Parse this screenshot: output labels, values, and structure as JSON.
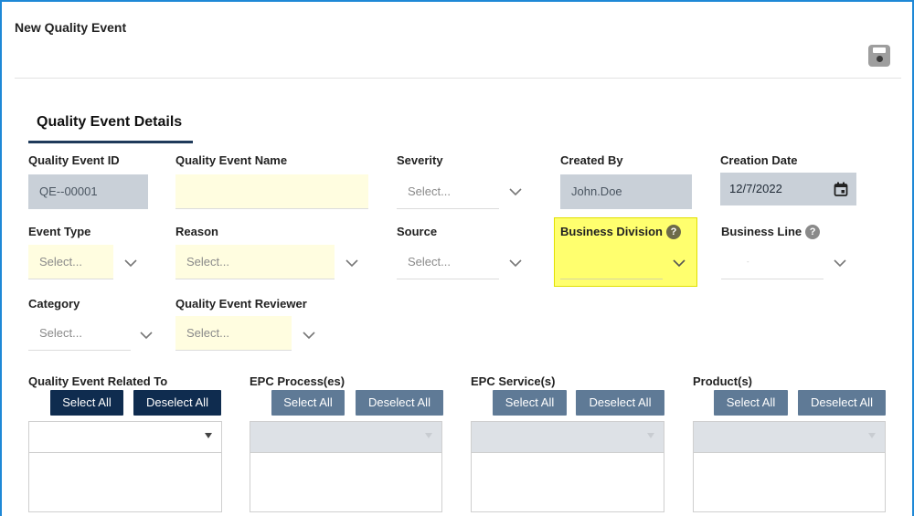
{
  "page": {
    "title": "New Quality Event",
    "save_icon": "floppy-disk-icon"
  },
  "tabs": {
    "active_label": "Quality Event Details"
  },
  "fields": {
    "event_id": {
      "label": "Quality Event ID",
      "value": "QE--00001"
    },
    "event_name": {
      "label": "Quality Event Name",
      "value": ""
    },
    "severity": {
      "label": "Severity",
      "placeholder": "Select..."
    },
    "created_by": {
      "label": "Created By",
      "value": "John.Doe"
    },
    "creation_date": {
      "label": "Creation Date",
      "value": "12/7/2022"
    },
    "event_type": {
      "label": "Event Type",
      "placeholder": "Select..."
    },
    "reason": {
      "label": "Reason",
      "placeholder": "Select..."
    },
    "source": {
      "label": "Source",
      "placeholder": "Select..."
    },
    "business_division": {
      "label": "Business Division",
      "help": "?",
      "value": ""
    },
    "business_line": {
      "label": "Business Line",
      "help": "?",
      "value": "-"
    },
    "category": {
      "label": "Category",
      "placeholder": "Select..."
    },
    "reviewer": {
      "label": "Quality Event Reviewer",
      "placeholder": "Select..."
    }
  },
  "multi_selects": [
    {
      "label": "Quality Event Related To",
      "select_all": "Select All",
      "deselect_all": "Deselect All",
      "enabled": true
    },
    {
      "label": "EPC Process(es)",
      "select_all": "Select All",
      "deselect_all": "Deselect All",
      "enabled": false
    },
    {
      "label": "EPC Service(s)",
      "select_all": "Select All",
      "deselect_all": "Deselect All",
      "enabled": false
    },
    {
      "label": "Product(s)",
      "select_all": "Select All",
      "deselect_all": "Deselect All",
      "enabled": false
    }
  ],
  "colors": {
    "frame_border": "#1e88d6",
    "tab_underline": "#1f3a5a",
    "readonly_bg": "#c9d0d8",
    "required_bg": "#fffde0",
    "highlight": "#ffff6e",
    "btn_dark": "#0f2c4f",
    "btn_light": "#5f7a96"
  }
}
